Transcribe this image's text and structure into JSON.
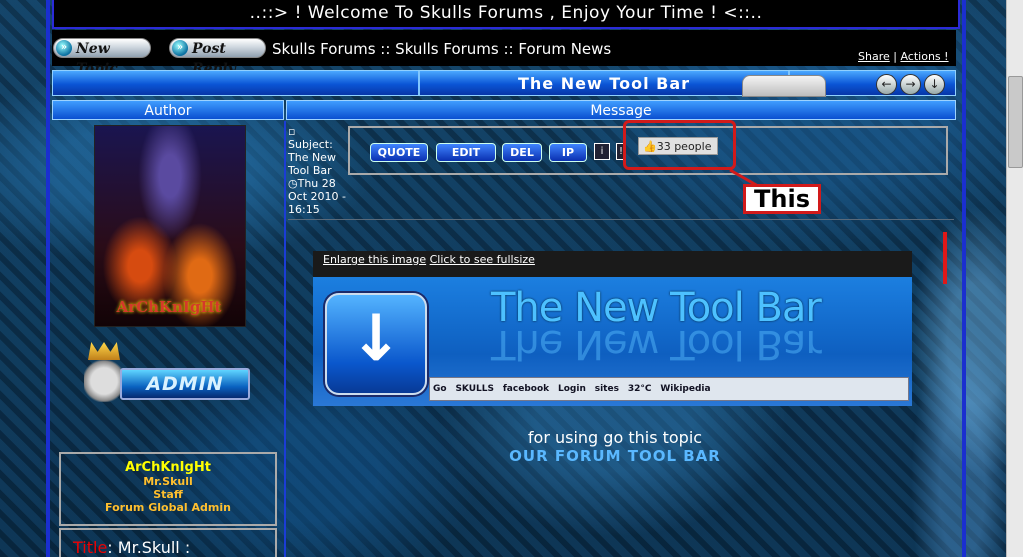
{
  "welcome_text": "..::> ! Welcome To Skulls Forums , Enjoy Your Time ! <::..",
  "actions": {
    "new_topic": "New Topic",
    "post_reply": "Post Reply"
  },
  "breadcrumb": "Skulls Forums :: Skulls Forums :: Forum News",
  "top_links": {
    "share": "Share",
    "separator": "|",
    "actions": "Actions !"
  },
  "topic_title": "The New Tool Bar",
  "columns": {
    "author": "Author",
    "message": "Message"
  },
  "post": {
    "subject_label": "Subject:",
    "subject": "The New Tool Bar",
    "date": "Thu 28 Oct 2010 - 16:15",
    "buttons": {
      "quote": "QUOTE",
      "edit": "EDIT",
      "del": "DEL",
      "ip": "IP"
    },
    "like_count": "33 people"
  },
  "annotation": "This",
  "author": {
    "avatar_text": "ArChKnIgHt",
    "badge": "ADMIN",
    "username": "ArChKnIgHt",
    "ranks": [
      "Mr.Skull",
      "Staff",
      "Forum Global Admin"
    ],
    "title_label": "Title",
    "title_value": ": Mr.Skull :"
  },
  "image": {
    "enlarge": "Enlarge this image",
    "fullsize": "Click to see fullsize",
    "banner_title": "The New Tool Bar",
    "toolbar_items": [
      "Go",
      "SKULLS",
      "facebook",
      "Login",
      "sites",
      "32°C",
      "Wikipedia"
    ]
  },
  "caption": {
    "line1": "for using go this topic",
    "line2": "OUR FORUM TOOL BAR"
  },
  "colors": {
    "accent_blue": "#0a4fd0",
    "highlight_red": "#d21a1a",
    "rank_orange": "#ffbf2e",
    "username_yellow": "#ffff00"
  }
}
